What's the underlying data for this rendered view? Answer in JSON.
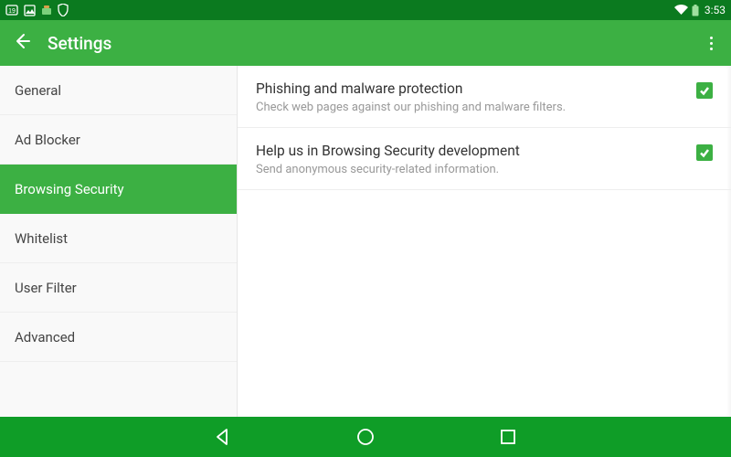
{
  "status": {
    "time": "3:53"
  },
  "header": {
    "title": "Settings"
  },
  "sidebar": {
    "items": [
      {
        "label": "General"
      },
      {
        "label": "Ad Blocker"
      },
      {
        "label": "Browsing Security",
        "selected": true
      },
      {
        "label": "Whitelist"
      },
      {
        "label": "User Filter"
      },
      {
        "label": "Advanced"
      }
    ]
  },
  "settings": [
    {
      "title": "Phishing and malware protection",
      "subtitle": "Check web pages against our phishing and malware filters.",
      "checked": true
    },
    {
      "title": "Help us in Browsing Security development",
      "subtitle": "Send anonymous security-related information.",
      "checked": true
    }
  ]
}
